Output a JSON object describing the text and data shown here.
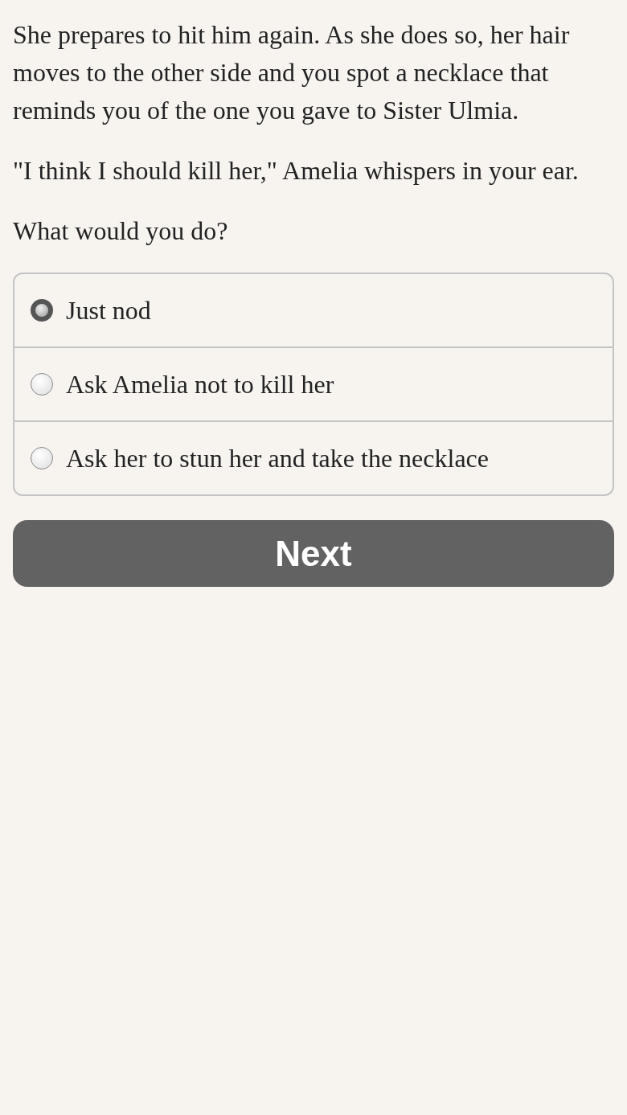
{
  "paragraphs": [
    "She prepares to hit him again. As she does so, her hair moves to the other side and you spot a necklace that reminds you of the one you gave to Sister Ulmia.",
    "\"I think I should kill her,\" Amelia whispers in your ear.",
    "What would you do?"
  ],
  "choices": [
    {
      "label": "Just nod",
      "selected": true
    },
    {
      "label": "Ask Amelia not to kill her",
      "selected": false
    },
    {
      "label": "Ask her to stun her and take the necklace",
      "selected": false
    }
  ],
  "next_button": {
    "label": "Next"
  }
}
